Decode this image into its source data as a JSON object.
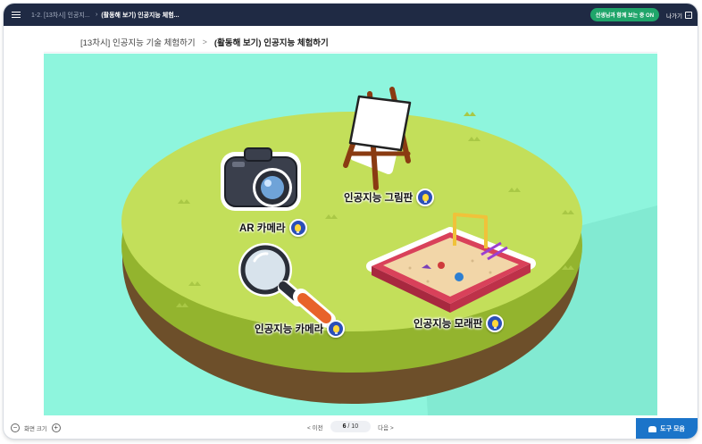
{
  "topbar": {
    "crumb_unit": "1-2. [13차시] 인공지...",
    "crumb_activity": "(활동해 보기) 인공지능 체험...",
    "teacher_badge": "선생님과 함께 보는 중 ON",
    "exit_label": "나가기"
  },
  "header": {
    "lesson": "[13차시] 인공지능 기술 체험하기",
    "separator": ">",
    "activity": "(활동해 보기) 인공지능 체험하기"
  },
  "stage": {
    "items": [
      {
        "label": "인공지능 그림판"
      },
      {
        "label": "AR 카메라"
      },
      {
        "label": "인공지능 카메라"
      },
      {
        "label": "인공지능 모래판"
      }
    ],
    "colors": {
      "background": "#8ef5dd",
      "grass_top": "#c3df5a",
      "grass_side": "#93b42e",
      "soil": "#6d4f2a",
      "bulb_button": "#2b4fb8"
    }
  },
  "bottombar": {
    "zoom_minus": "−",
    "zoom_label": "화면 크기",
    "zoom_plus": "+",
    "prev_label": "< 이전",
    "page_current": "6",
    "page_total": "/ 10",
    "next_label": "다음 >",
    "tools_label": "도구 모음"
  }
}
